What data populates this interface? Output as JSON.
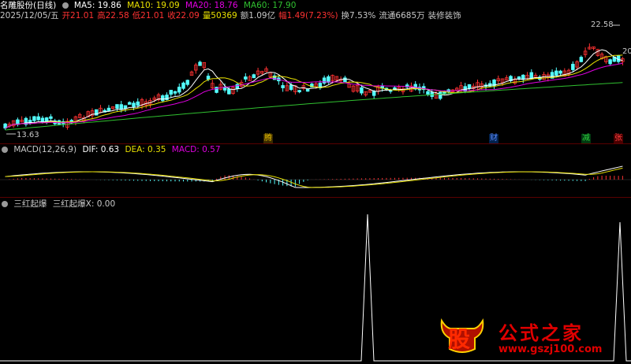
{
  "header": {
    "stock_name": "名雕股份(日线)",
    "ma5": "MA5: 19.86",
    "ma10": "MA10: 19.09",
    "ma20": "MA20: 18.76",
    "ma60": "MA60: 17.90",
    "date": "2025/12/05/五",
    "open": "开21.01",
    "high": "高22.58",
    "low": "低21.01",
    "close": "收22.09",
    "volume": "量50369",
    "amount": "额1.09亿",
    "change": "幅1.49(7.23%)",
    "turnover": "换7.53%",
    "float": "流通6685万",
    "industry": "装修装饰"
  },
  "price_panel": {
    "high_label": "22.58",
    "low_label": "13.63",
    "edge_label": "20",
    "tags": [
      "腾",
      "财",
      "减",
      "张"
    ]
  },
  "macd": {
    "title": "MACD(12,26,9)",
    "dif": "DIF: 0.63",
    "dea": "DEA: 0.35",
    "macd": "MACD: 0.57"
  },
  "indicator": {
    "title": "三红起爆",
    "value": "三红起爆X: 0.00"
  },
  "watermark": {
    "logo": "股",
    "name": "公式之家",
    "url": "www.gszj100.com"
  },
  "colors": {
    "ma5": "#ffffff",
    "ma10": "#e8e000",
    "ma20": "#e000e0",
    "ma60": "#30c030",
    "up": "#ff3232",
    "down": "#54ffff",
    "axis_red": "#ff3232"
  }
}
